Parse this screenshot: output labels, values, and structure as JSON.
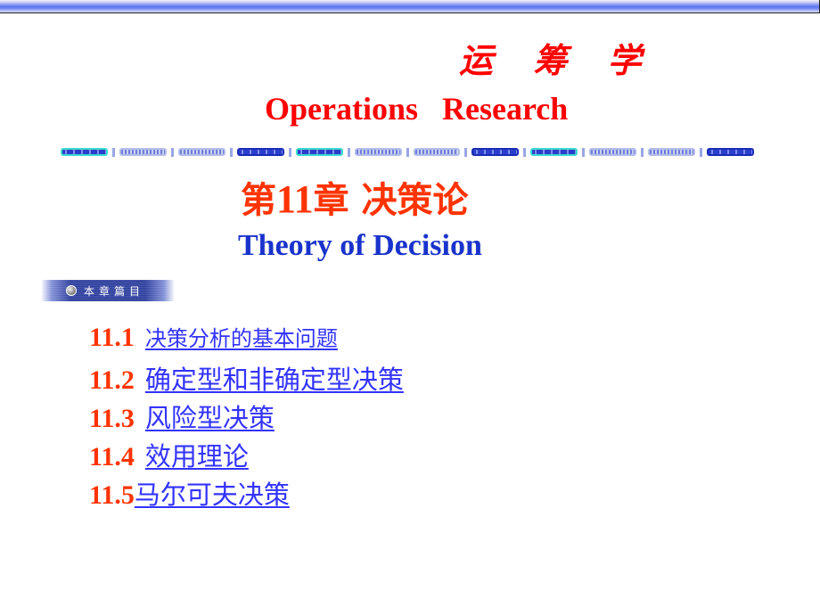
{
  "header": {
    "cn_title": "运 筹 学",
    "en_title": "Operations   Research"
  },
  "chapter": {
    "prefix": "第",
    "number": "11",
    "suffix": "章 决策论",
    "subtitle": "Theory of Decision"
  },
  "section_badge": {
    "label": "本章篇目",
    "icon": "bullet-orb-icon"
  },
  "toc": [
    {
      "number": "11.1",
      "title": "决策分析的基本问题"
    },
    {
      "number": "11.2",
      "title": "确定型和非确定型决策"
    },
    {
      "number": "11.3",
      "title": "风险型决策"
    },
    {
      "number": "11.4",
      "title": "效用理论"
    },
    {
      "number": "11.5",
      "title": "马尔可夫决策"
    }
  ],
  "colors": {
    "title_red": "#ff0000",
    "chapter_red": "#ff3300",
    "subtitle_blue": "#1a33cc",
    "link_blue": "#3333ff",
    "badge_navy": "#2e3f9e"
  }
}
